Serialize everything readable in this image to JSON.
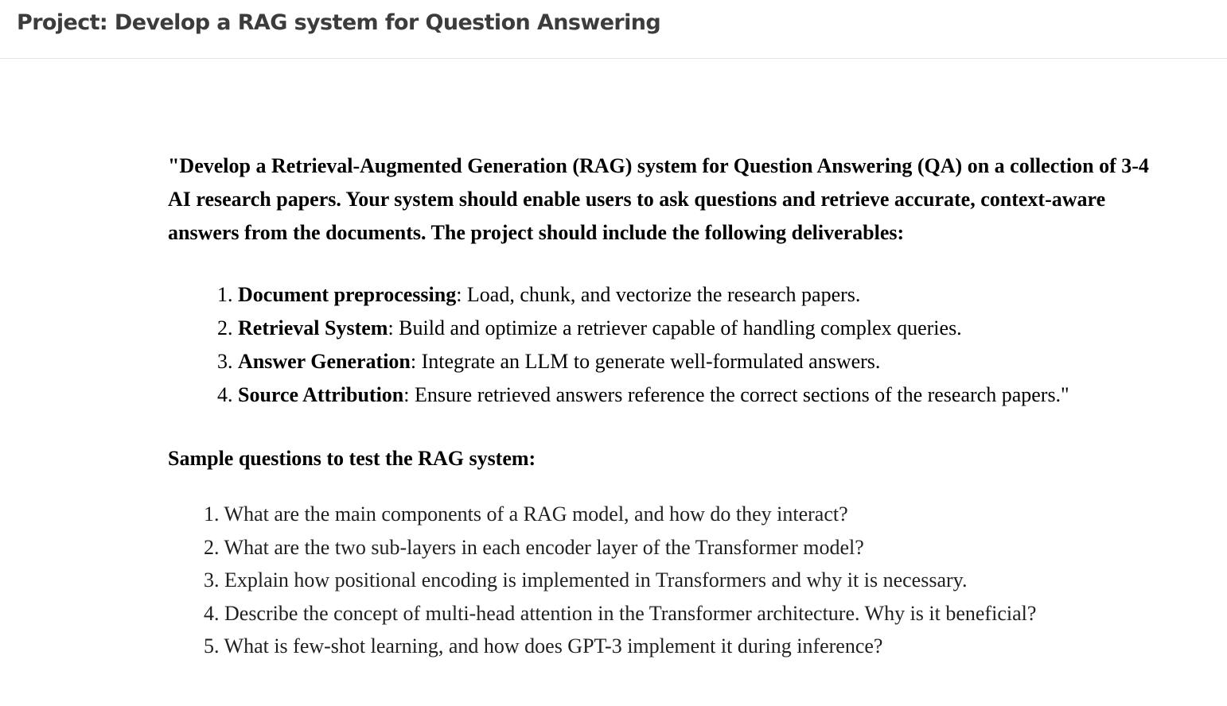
{
  "header": {
    "title": "Project: Develop a RAG system for Question Answering"
  },
  "intro": {
    "text": "\"Develop a Retrieval-Augmented Generation (RAG) system for Question Answering (QA) on a collection of 3-4 AI research papers. Your system should enable users to ask questions and retrieve accurate, context-aware answers from the documents. The project should include the following deliverables:"
  },
  "deliverables": [
    {
      "number": "1.",
      "title": "Document preprocessing",
      "description": ": Load, chunk, and vectorize the research papers."
    },
    {
      "number": "2.",
      "title": "Retrieval System",
      "description": ": Build and optimize a retriever capable of handling complex queries."
    },
    {
      "number": "3.",
      "title": "Answer Generation",
      "description": ": Integrate an LLM to generate well-formulated answers."
    },
    {
      "number": "4.",
      "title": "Source Attribution",
      "description": ": Ensure retrieved answers reference the correct sections of the research papers.\""
    }
  ],
  "sample": {
    "heading": "Sample questions to test the RAG system:",
    "questions": [
      {
        "number": "1.",
        "text": "What are the main components of a RAG model, and how do they interact?"
      },
      {
        "number": "2.",
        "text": "What are the two sub-layers in each encoder layer of the Transformer model?"
      },
      {
        "number": "3.",
        "text": "Explain how positional encoding is implemented in Transformers and why it is necessary."
      },
      {
        "number": "4.",
        "text": "Describe the concept of multi-head attention in the Transformer architecture. Why is it beneficial?"
      },
      {
        "number": "5.",
        "text": "What is few-shot learning, and how does GPT-3 implement it during inference?"
      }
    ]
  }
}
